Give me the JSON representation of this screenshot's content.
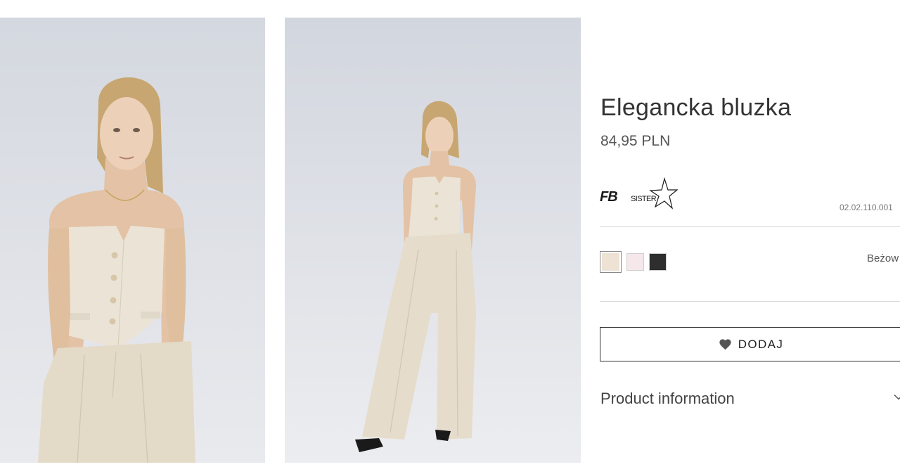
{
  "product": {
    "title": "Elegancka bluzka",
    "price": "84,95 PLN",
    "sku": "02.02.110.001",
    "selected_color": "Beżow",
    "brand_logo_text": "FB SISTER"
  },
  "colors": [
    {
      "name": "beige",
      "hex": "#ede2d4",
      "selected": true
    },
    {
      "name": "pink",
      "hex": "#f6e7ea",
      "selected": false
    },
    {
      "name": "black",
      "hex": "#2e2e2e",
      "selected": false
    }
  ],
  "actions": {
    "add_label": "DODAJ",
    "add_icon": "heart-icon"
  },
  "sections": {
    "product_information": "Product information",
    "toggle_icon": "chevron-down-icon"
  },
  "images": [
    {
      "name": "product-photo-front-closeup"
    },
    {
      "name": "product-photo-full-body"
    }
  ],
  "theme": {
    "text": "#333333",
    "divider": "#d8d8d8",
    "garment": "#e9e1d3",
    "backdrop": "#dfe1e6"
  }
}
